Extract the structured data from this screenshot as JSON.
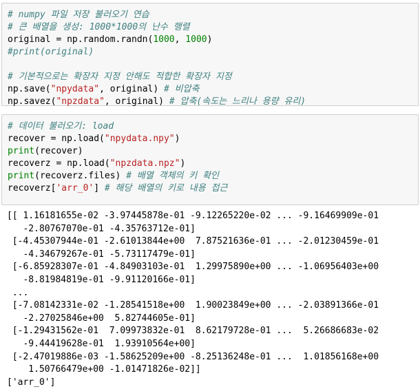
{
  "cell1": {
    "lines": [
      [
        {
          "t": "cm",
          "v": "# numpy 파일 저장 불러오기 연습"
        }
      ],
      [
        {
          "t": "cm",
          "v": "# 큰 배열을 생성: 1000*1000의 난수 행렬"
        }
      ],
      [
        {
          "t": "plain",
          "v": "original = np.random.randn("
        },
        {
          "t": "num",
          "v": "1000"
        },
        {
          "t": "plain",
          "v": ", "
        },
        {
          "t": "num",
          "v": "1000"
        },
        {
          "t": "plain",
          "v": ")"
        }
      ],
      [
        {
          "t": "cm",
          "v": "#print(original)"
        }
      ],
      [],
      [
        {
          "t": "cm",
          "v": "# 기본적으로는 확장자 지정 안해도 적합한 확장자 지정"
        }
      ],
      [
        {
          "t": "plain",
          "v": "np.save("
        },
        {
          "t": "str",
          "v": "\"npydata\""
        },
        {
          "t": "plain",
          "v": ", original) "
        },
        {
          "t": "cm",
          "v": "# 비압축"
        }
      ],
      [
        {
          "t": "plain",
          "v": "np.savez("
        },
        {
          "t": "str",
          "v": "\"npzdata\""
        },
        {
          "t": "plain",
          "v": ", original) "
        },
        {
          "t": "cm",
          "v": "# 압축(속도는 느리나 용량 유리)"
        }
      ]
    ]
  },
  "cell2": {
    "lines": [
      [
        {
          "t": "cm",
          "v": "# 데이터 불러오기: load"
        }
      ],
      [
        {
          "t": "plain",
          "v": "recover = np.load("
        },
        {
          "t": "str",
          "v": "\"npydata.npy\""
        },
        {
          "t": "plain",
          "v": ")"
        }
      ],
      [
        {
          "t": "kw",
          "v": "print"
        },
        {
          "t": "plain",
          "v": "(recover)"
        }
      ],
      [
        {
          "t": "plain",
          "v": "recoverz = np.load("
        },
        {
          "t": "str",
          "v": "\"npzdata.npz\""
        },
        {
          "t": "plain",
          "v": ")"
        }
      ],
      [
        {
          "t": "kw",
          "v": "print"
        },
        {
          "t": "plain",
          "v": "(recoverz.files) "
        },
        {
          "t": "cm",
          "v": "# 배열 객체의 키 확인"
        }
      ],
      [
        {
          "t": "plain",
          "v": "recoverz["
        },
        {
          "t": "str",
          "v": "'arr_0'"
        },
        {
          "t": "plain",
          "v": "] "
        },
        {
          "t": "cm",
          "v": "# 해당 배열의 키로 내용 접근"
        }
      ]
    ]
  },
  "output": {
    "lines": [
      "[[ 1.16181655e-02 -3.97445878e-01 -9.12265220e-02 ... -9.16469909e-01",
      "   -2.80767070e-01 -4.35763712e-01]",
      " [-4.45307944e-01 -2.61013844e+00  7.87521636e-01 ... -2.01230459e-01",
      "   -4.34679267e-01 -5.73117479e-01]",
      " [-6.85928307e-01 -4.84903103e-01  1.29975890e+00 ... -1.06956403e+00",
      "   -8.81984819e-01 -9.91120166e-01]",
      " ...",
      " [-7.08142331e-02 -1.28541518e+00  1.90023849e+00 ... -2.03891366e-01",
      "   -2.27025846e+00  5.82744605e-01]",
      " [-1.29431562e-01  7.09973832e-01  8.62179728e-01 ...  5.26686683e-02",
      "   -9.44419628e-01  1.93910564e+00]",
      " [-2.47019886e-03 -1.58625209e+00 -8.25136248e-01 ...  1.01856168e+00",
      "    1.50766479e+00 -1.01471826e-02]]",
      "['arr_0']"
    ]
  }
}
